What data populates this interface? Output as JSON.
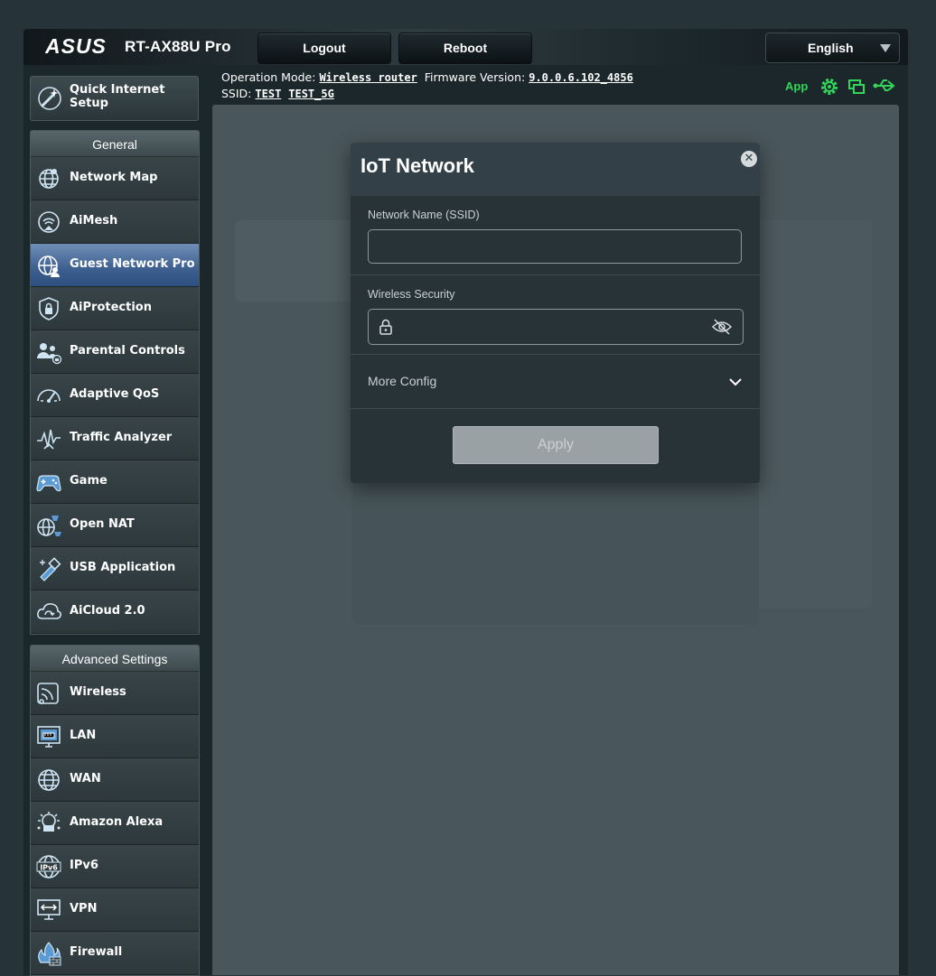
{
  "header": {
    "brand": "ASUS",
    "model": "RT-AX88U Pro",
    "logout_label": "Logout",
    "reboot_label": "Reboot",
    "language": "English"
  },
  "status": {
    "op_mode_label": "Operation Mode:",
    "op_mode_value": "Wireless router",
    "firmware_label": "Firmware Version:",
    "firmware_value": "9.0.0.6.102_4856",
    "ssid_label": "SSID:",
    "ssid_1": "TEST",
    "ssid_2": "TEST_5G",
    "app_label": "App",
    "accent": "#31d65a"
  },
  "sidebar": {
    "qis_label": "Quick Internet Setup",
    "general_title": "General",
    "general_items": [
      {
        "label": "Network Map",
        "icon": "network-map-icon"
      },
      {
        "label": "AiMesh",
        "icon": "aimesh-icon"
      },
      {
        "label": "Guest Network Pro",
        "icon": "guest-network-icon",
        "active": true
      },
      {
        "label": "AiProtection",
        "icon": "aiprotection-icon"
      },
      {
        "label": "Parental Controls",
        "icon": "parental-controls-icon"
      },
      {
        "label": "Adaptive QoS",
        "icon": "qos-gauge-icon"
      },
      {
        "label": "Traffic Analyzer",
        "icon": "traffic-analyzer-icon"
      },
      {
        "label": "Game",
        "icon": "gamepad-icon"
      },
      {
        "label": "Open NAT",
        "icon": "open-nat-icon"
      },
      {
        "label": "USB Application",
        "icon": "usb-icon"
      },
      {
        "label": "AiCloud 2.0",
        "icon": "cloud-icon"
      }
    ],
    "advanced_title": "Advanced Settings",
    "advanced_items": [
      {
        "label": "Wireless",
        "icon": "wireless-icon"
      },
      {
        "label": "LAN",
        "icon": "lan-icon"
      },
      {
        "label": "WAN",
        "icon": "globe-icon"
      },
      {
        "label": "Amazon Alexa",
        "icon": "alexa-icon"
      },
      {
        "label": "IPv6",
        "icon": "ipv6-icon"
      },
      {
        "label": "VPN",
        "icon": "vpn-icon"
      },
      {
        "label": "Firewall",
        "icon": "firewall-icon"
      }
    ]
  },
  "modal": {
    "title": "IoT Network",
    "ssid_label": "Network Name (SSID)",
    "ssid_value": "",
    "security_label": "Wireless Security",
    "security_value": "",
    "more_config_label": "More Config",
    "apply_label": "Apply"
  }
}
